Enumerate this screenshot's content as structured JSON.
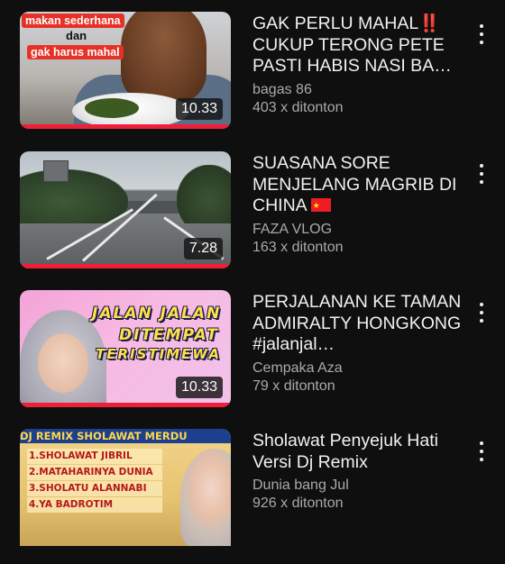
{
  "feed": {
    "videos": [
      {
        "title": "GAK PERLU MAHAL‼️ CUKUP TERONG PETE PASTI HABIS NASI BA…",
        "channel": "bagas 86",
        "views": "403 x ditonton",
        "duration": "10.33",
        "thumb_text": [
          "makan sederhana",
          "dan",
          "gak harus mahal"
        ],
        "watched_fraction": 1.0
      },
      {
        "title": "SUASANA SORE MENJELANG MAGRIB DI CHINA",
        "title_flag": "china-flag",
        "channel": "FAZA VLOG",
        "views": "163 x ditonton",
        "duration": "7.28",
        "watched_fraction": 1.0
      },
      {
        "title": "PERJALANAN KE TAMAN ADMIRALTY HONGKONG #jalanjal…",
        "channel": "Cempaka Aza",
        "views": "79 x ditonton",
        "duration": "10.33",
        "thumb_text": [
          "JALAN JALAN",
          "DITEMPAT",
          "TERISTIMEWA"
        ],
        "watched_fraction": 1.0
      },
      {
        "title": "Sholawat Penyejuk Hati Versi Dj Remix",
        "channel": "Dunia bang Jul",
        "views": "926 x ditonton",
        "thumb_text": [
          "DJ REMIX SHOLAWAT MERDU",
          "1.SHOLAWAT JIBRIL",
          "2.MATAHARINYA DUNIA",
          "3.SHOLATU ALANNABI",
          "4.YA BADROTIM"
        ]
      }
    ],
    "menu_icon": "more-vert-icon",
    "colors": {
      "background": "#0f0f0f",
      "progress": "#ef1f3a",
      "subtext": "#aaaaaa"
    }
  }
}
